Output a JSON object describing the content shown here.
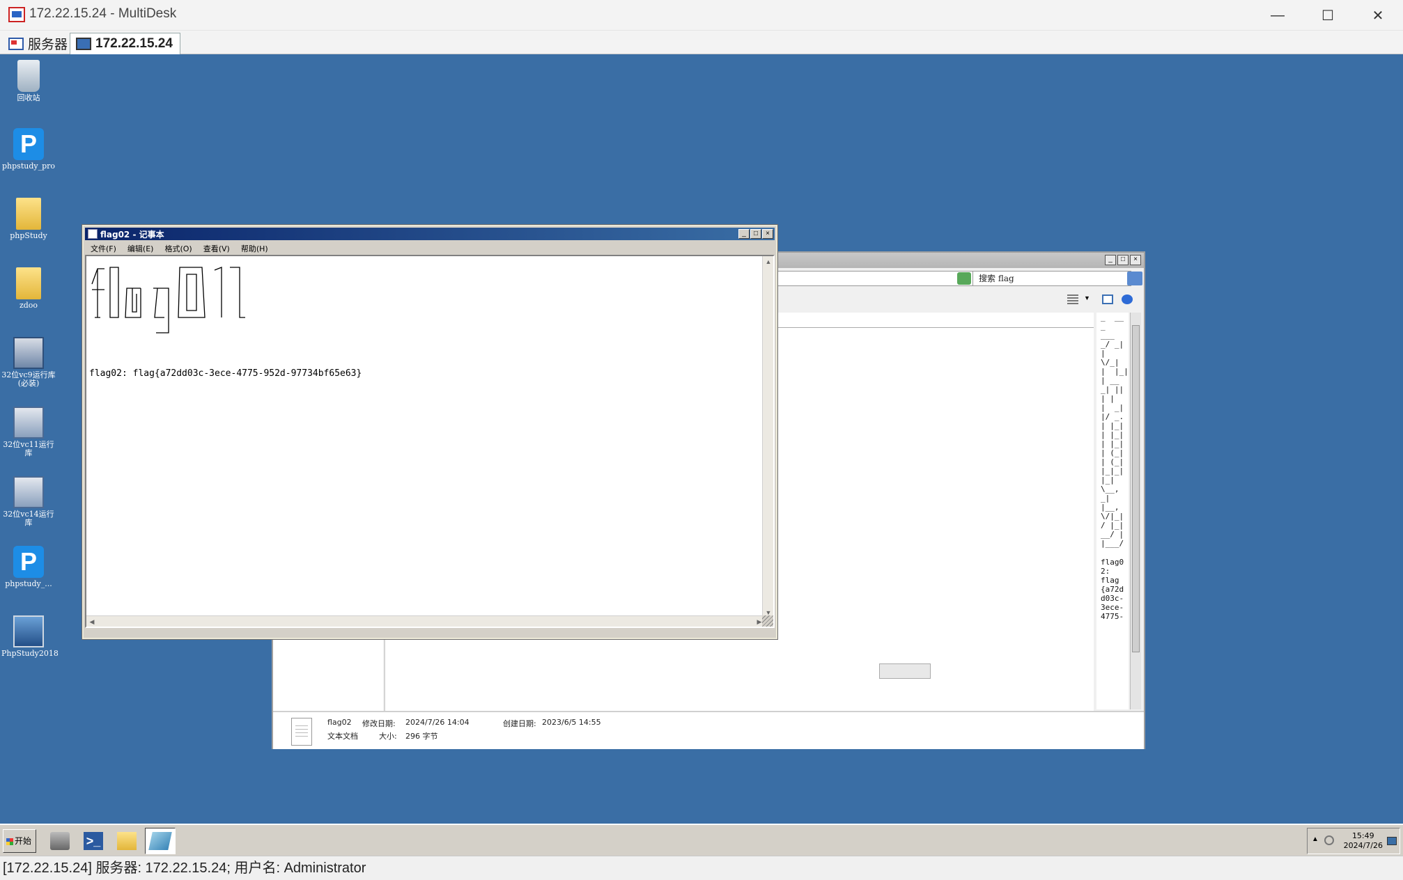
{
  "multidesk": {
    "title": "172.22.15.24 - MultiDesk",
    "minimize": "—",
    "maximize": "☐",
    "close": "✕",
    "tabs": [
      {
        "label": "服务器"
      },
      {
        "label": "172.22.15.24"
      }
    ]
  },
  "desktop": {
    "icons": [
      {
        "label": "回收站"
      },
      {
        "label": "phpstudy_pro"
      },
      {
        "label": "phpStudy"
      },
      {
        "label": "zdoo"
      },
      {
        "label": "32位vc9运行库(必装)"
      },
      {
        "label": "32位vc11运行库"
      },
      {
        "label": "32位vc14运行库"
      },
      {
        "label": "phpstudy_..."
      },
      {
        "label": "PhpStudy2018"
      }
    ]
  },
  "notepad": {
    "title": "flag02 - 记事本",
    "menus": [
      "文件(F)",
      "编辑(E)",
      "格式(O)",
      "查看(V)",
      "帮助(H)"
    ],
    "flag_line": "flag02: flag{a72dd03c-3ece-4775-952d-97734bf65e63}"
  },
  "explorer": {
    "search_text": "搜索 flag",
    "preview_art": "_  __\n_\n___\n_/ _|\n|\n\\/_|\n|  |_|\n| __\n_| ||\n| |\n|  _|\n|/ _.\n| |_|\n| |_|\n| |_|\n| (_|\n| (_|\n|_|_|\n|_|\n\\__,\n_|\n|__,\n\\/|_|\n/ |_|\n__/ |\n|___/",
    "preview_text": "flag0\n2:\nflag\n{a72d\nd03c-\n3ece-\n4775-",
    "file_name": "flag02",
    "modified_label": "修改日期:",
    "modified_value": "2024/7/26 14:04",
    "created_label": "创建日期:",
    "created_value": "2023/6/5 14:55",
    "file_type": "文本文档",
    "size_label": "大小:",
    "size_value": "296 字节"
  },
  "taskbar": {
    "start_label": "开始",
    "time": "15:49",
    "date": "2024/7/26"
  },
  "statusbar": {
    "text": "[172.22.15.24] 服务器: 172.22.15.24; 用户名: Administrator"
  },
  "colors": {
    "desktop": "#3a6ea5",
    "notepad_caption": "#0a246a",
    "accent": "#2e6bd6"
  }
}
